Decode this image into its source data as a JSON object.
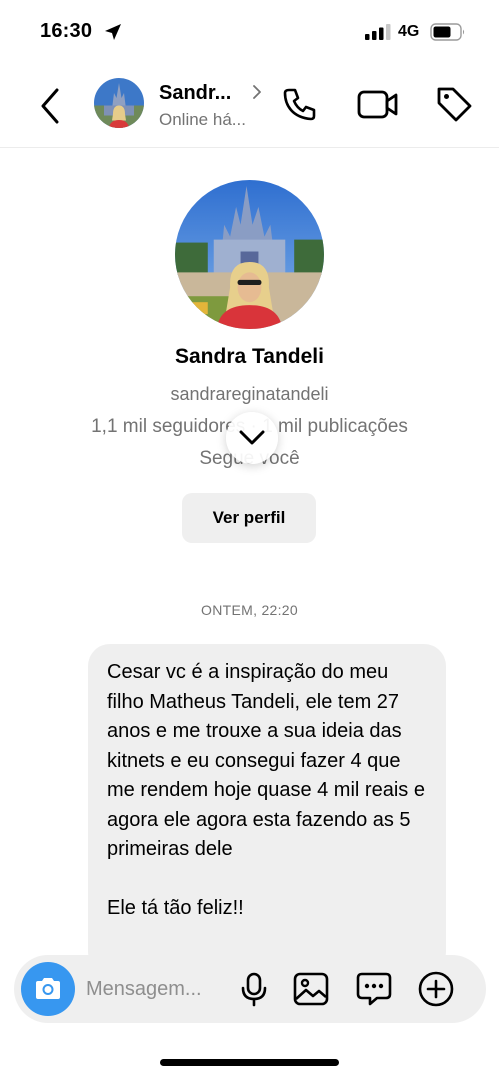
{
  "status_bar": {
    "time": "16:30",
    "network": "4G",
    "icons": [
      "location-arrow-icon",
      "signal-icon",
      "battery-icon"
    ]
  },
  "header": {
    "contact_name": "Sandr...",
    "contact_status": "Online há...",
    "icons": [
      "back-arrow-icon",
      "chevron-right-icon",
      "phone-icon",
      "video-camera-icon",
      "tag-icon"
    ]
  },
  "profile": {
    "display_name": "Sandra Tandeli",
    "username": "sandrareginatandeli",
    "stats": "1,1 mil seguidores · 1 mil publicações",
    "follow_status": "Segue você",
    "view_profile_label": "Ver perfil"
  },
  "conversation": {
    "timestamp": "ONTEM, 22:20",
    "messages": [
      {
        "sender": "contact",
        "paragraphs": [
          "Cesar vc é a inspiração do meu filho Matheus Tandeli, ele tem 27 anos e me trouxe a sua ideia das kitnets e eu consegui fazer 4 que me rendem hoje quase 4 mil reais e agora ele agora esta fazendo as 5 primeiras dele",
          "Ele tá tão feliz!!"
        ]
      }
    ]
  },
  "composer": {
    "placeholder": "Mensagem...",
    "icons": [
      "camera-icon",
      "microphone-icon",
      "image-gallery-icon",
      "sticker-icon",
      "plus-icon"
    ]
  },
  "colors": {
    "accent_blue": "#3797f0",
    "bubble_gray": "#efefef",
    "secondary_text": "#737373"
  }
}
